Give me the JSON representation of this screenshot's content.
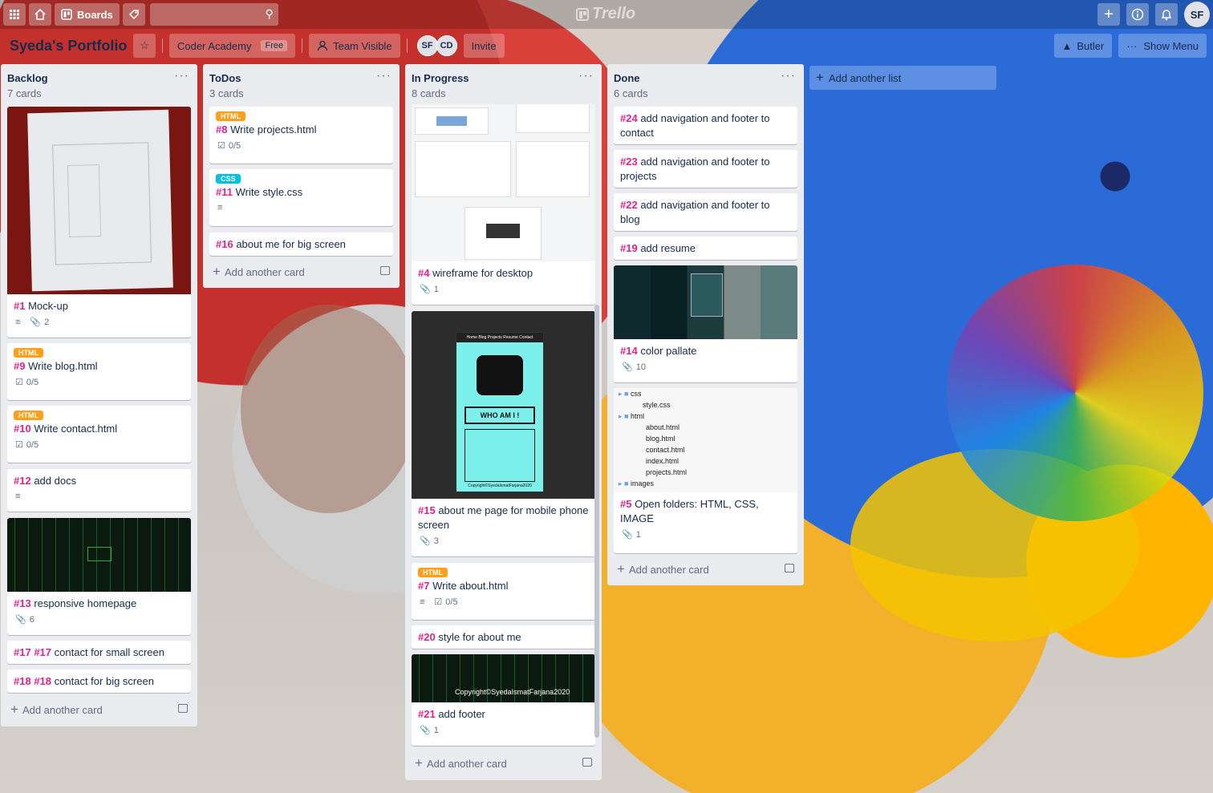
{
  "topbar": {
    "boards_label": "Boards",
    "search_value": "",
    "logo_text": "Trello",
    "avatar": "SF"
  },
  "board": {
    "title": "Syeda's Portfolio",
    "team": "Coder Academy",
    "team_badge": "Free",
    "visibility": "Team Visible",
    "members": [
      "SF",
      "CD"
    ],
    "invite": "Invite",
    "butler": "Butler",
    "show_menu": "Show Menu"
  },
  "lists": [
    {
      "name": "Backlog",
      "count": "7 cards",
      "add_card": "Add another card",
      "cards": [
        {
          "num": "#1",
          "title": "Mock-up",
          "attachments": "2"
        },
        {
          "label": "HTML",
          "num": "#9",
          "title": "Write blog.html",
          "checklist": "0/5"
        },
        {
          "label": "HTML",
          "num": "#10",
          "title": "Write contact.html",
          "checklist": "0/5"
        },
        {
          "num": "#12",
          "title": "add docs"
        },
        {
          "num": "#13",
          "title": "responsive homepage",
          "attachments": "6"
        },
        {
          "num": "#17",
          "num2": "#17",
          "title": "contact for small screen"
        },
        {
          "num": "#18",
          "num2": "#18",
          "title": "contact for big screen"
        }
      ]
    },
    {
      "name": "ToDos",
      "count": "3 cards",
      "add_card": "Add another card",
      "cards": [
        {
          "label": "HTML",
          "num": "#8",
          "title": "Write projects.html",
          "checklist": "0/5"
        },
        {
          "label": "CSS",
          "num": "#11",
          "title": "Write style.css"
        },
        {
          "num": "#16",
          "title": "about me for big screen"
        }
      ]
    },
    {
      "name": "In Progress",
      "count": "8 cards",
      "add_card": "Add another card",
      "cards": [
        {
          "num": "#4",
          "title": "wireframe for desktop",
          "attachments": "1"
        },
        {
          "num": "#15",
          "title": "about me page for mobile phone screen",
          "attachments": "3",
          "cover_heading": "WHO AM I !",
          "cover_nav": "Home  Blog  Projects  Resume  Contact",
          "cover_footer": "Copyright©SyedaIsmatFarjana2020"
        },
        {
          "label": "HTML",
          "num": "#7",
          "title": "Write about.html",
          "checklist": "0/5"
        },
        {
          "num": "#20",
          "title": "style for about me"
        },
        {
          "num": "#21",
          "title": "add footer",
          "attachments": "1",
          "cover_text": "Copyright©SyedaIsmatFarjana2020"
        }
      ]
    },
    {
      "name": "Done",
      "count": "6 cards",
      "add_card": "Add another card",
      "cards": [
        {
          "num": "#24",
          "title": "add navigation and footer to contact"
        },
        {
          "num": "#23",
          "title": "add navigation and footer to projects"
        },
        {
          "num": "#22",
          "title": "add navigation and footer to blog"
        },
        {
          "num": "#19",
          "title": "add resume"
        },
        {
          "num": "#14",
          "title": "color pallate",
          "attachments": "10"
        },
        {
          "num": "#5",
          "title": "Open folders: HTML, CSS, IMAGE",
          "attachments": "1",
          "tree": [
            "css",
            "style.css",
            "html",
            "about.html",
            "blog.html",
            "contact.html",
            "index.html",
            "projects.html",
            "images"
          ]
        }
      ]
    }
  ],
  "add_list": "Add another list",
  "colors": {
    "number": "#e0228f",
    "html_label": "#ff9f1a",
    "css_label": "#00c2e0",
    "list_bg": "#ebecf0"
  }
}
